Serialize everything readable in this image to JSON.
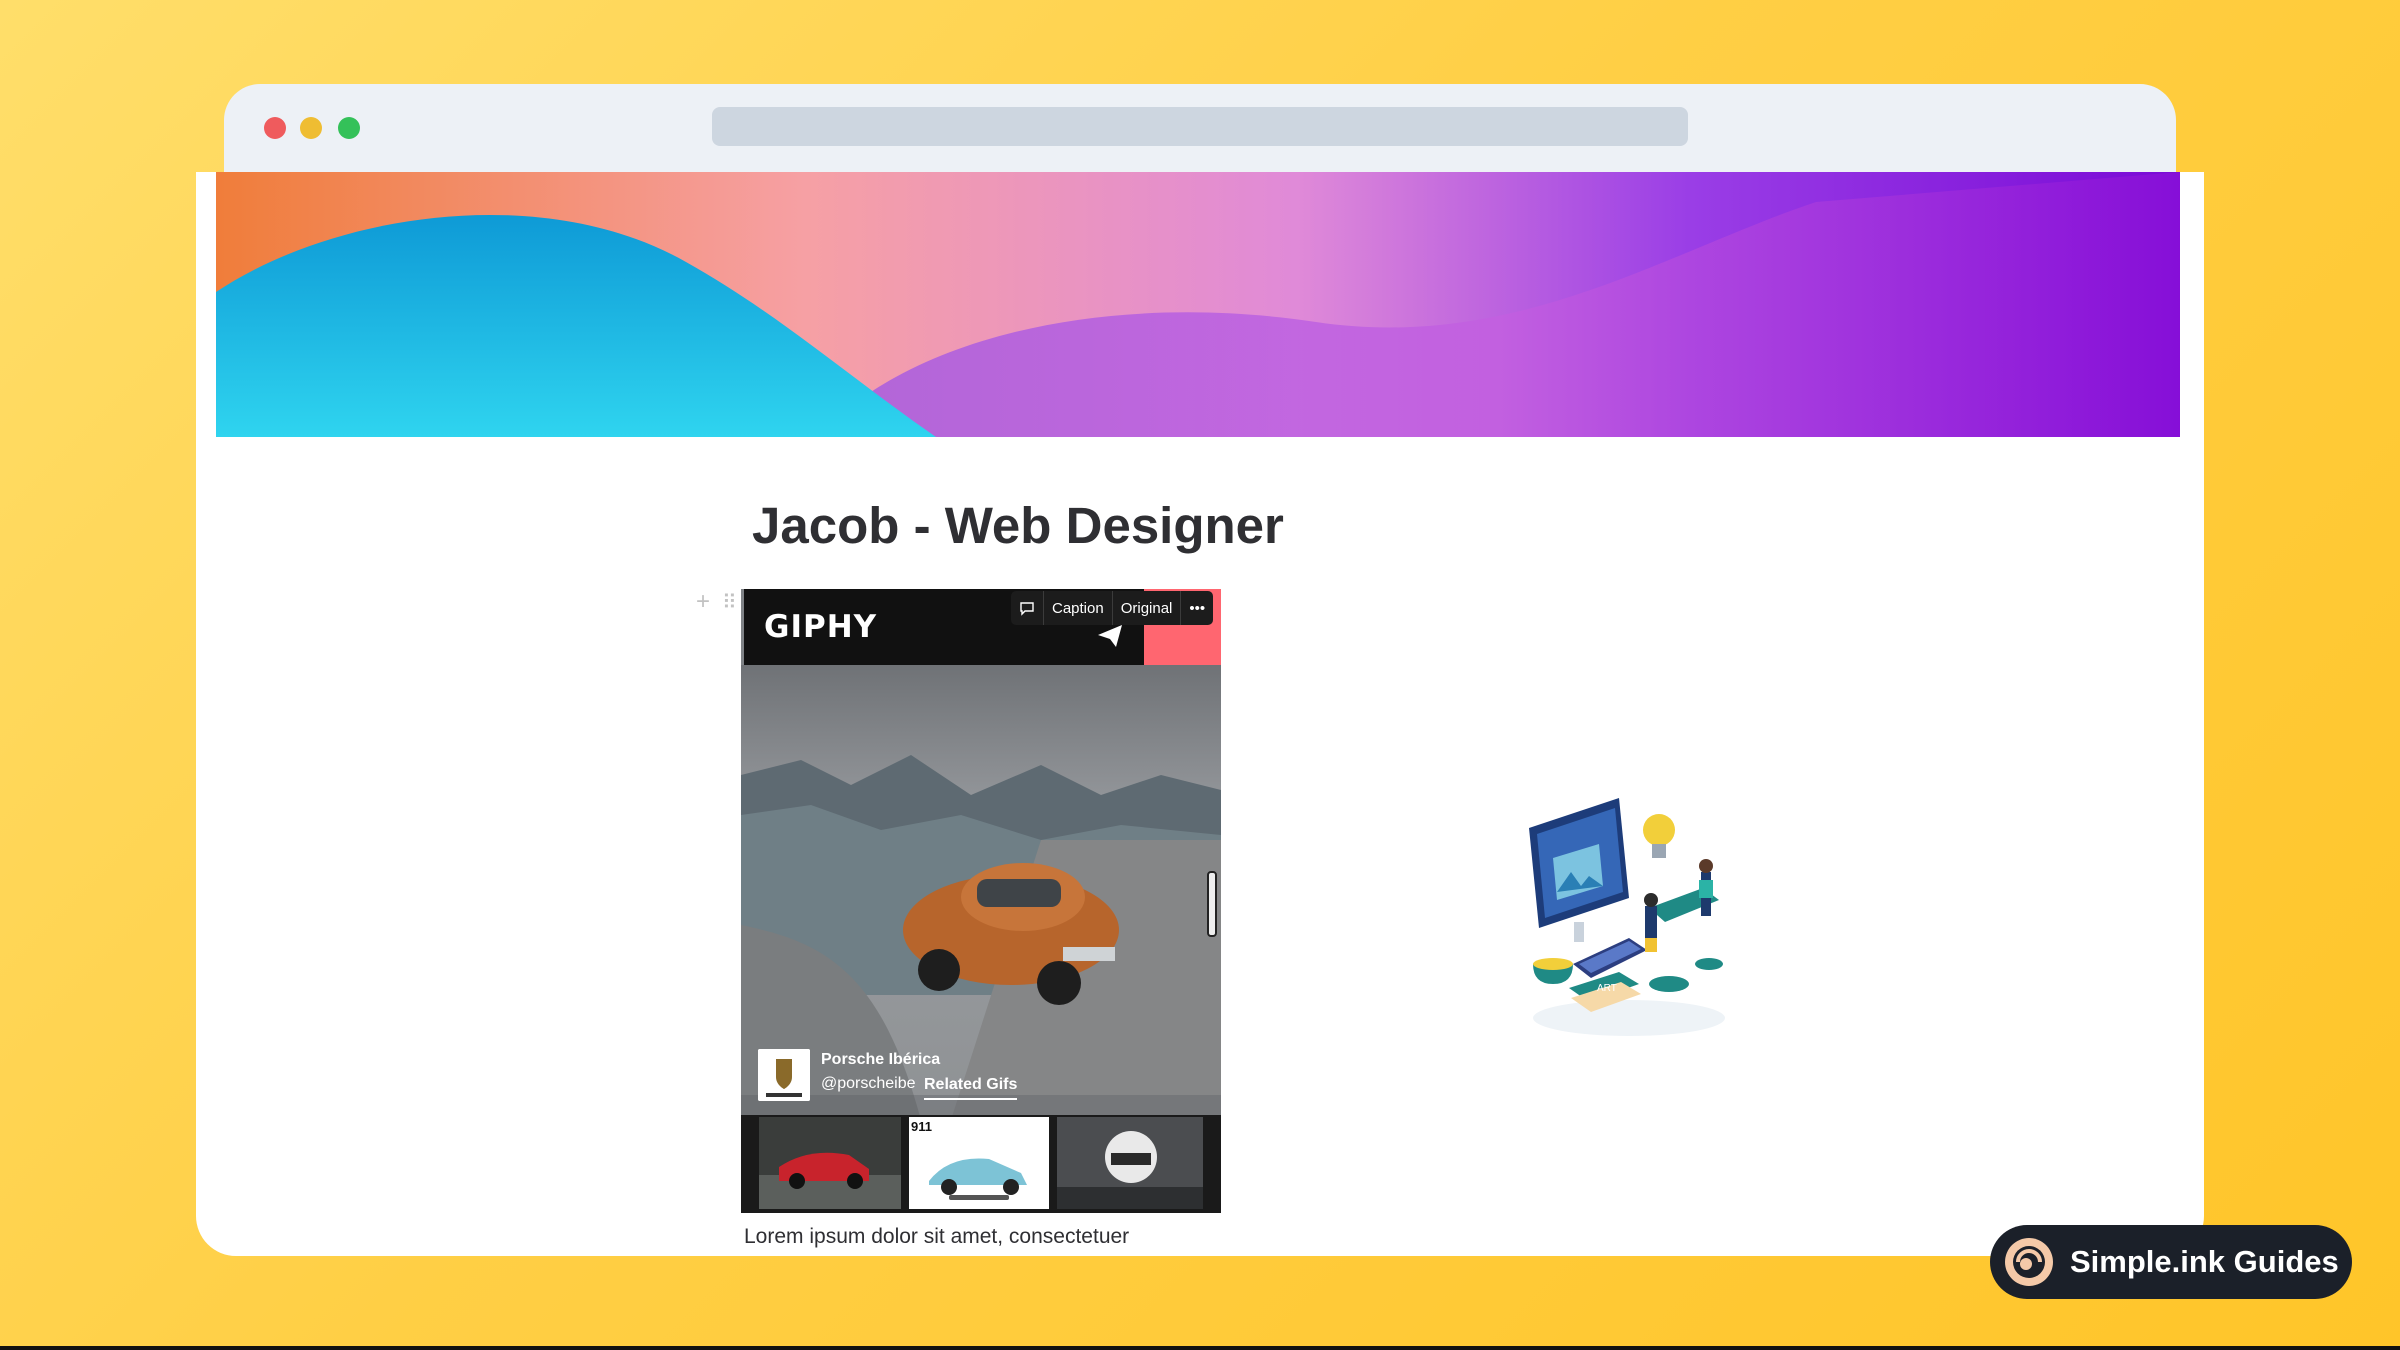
{
  "page": {
    "title": "Jacob - Web Designer",
    "body_text": "Lorem ipsum dolor sit amet, consectetuer"
  },
  "embed": {
    "provider": "GIPHY",
    "toolbar": {
      "caption": "Caption",
      "original": "Original",
      "more": "•••"
    },
    "channel_name": "Porsche Ibérica",
    "channel_handle": "@porscheibe",
    "related_label": "Related Gifs",
    "thumb_badge": "911"
  },
  "illustration_label": "ART",
  "badge": {
    "label": "Simple.ink Guides"
  },
  "icons": [
    "comment-icon",
    "send-icon",
    "plus-icon",
    "drag-handle-icon",
    "simpleink-logo-icon"
  ],
  "colors": {
    "background": "#ffcf45",
    "giphy_accent": "#ff6670",
    "badge_bg": "#1b2029"
  }
}
